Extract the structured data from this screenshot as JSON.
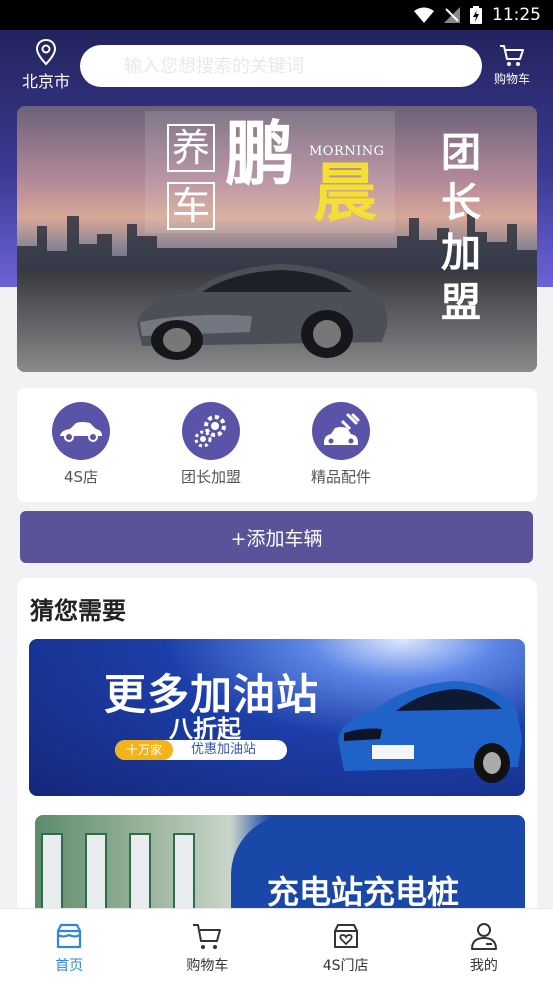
{
  "status_bar": {
    "time": "11:25"
  },
  "header": {
    "location": "北京市",
    "search_placeholder": "输入您想搜索的关键词",
    "cart_label": "购物车"
  },
  "banner": {
    "char_yang": "养",
    "char_che": "车",
    "char_peng": "鹏",
    "morning": "MORNING",
    "char_chen": "晨",
    "vertical_text": "团长加盟"
  },
  "quick_actions": [
    {
      "label": "4S店",
      "icon": "car-icon"
    },
    {
      "label": "团长加盟",
      "icon": "gears-icon"
    },
    {
      "label": "精品配件",
      "icon": "car-repair-icon"
    }
  ],
  "add_vehicle": {
    "label": "+添加车辆"
  },
  "recommend": {
    "title": "猜您需要",
    "promo_gas": {
      "headline": "更多加油站",
      "sub": "八折起",
      "tag": "十万家",
      "tag_text": "优惠加油站"
    },
    "promo_charge": {
      "headline": "充电站充电桩"
    }
  },
  "tabbar": [
    {
      "label": "首页",
      "icon": "home-store-icon",
      "active": true
    },
    {
      "label": "购物车",
      "icon": "cart-icon",
      "active": false
    },
    {
      "label": "4S门店",
      "icon": "shop-heart-icon",
      "active": false
    },
    {
      "label": "我的",
      "icon": "user-icon",
      "active": false
    }
  ],
  "colors": {
    "primary": "#5a539a",
    "tab_active": "#2f86e0",
    "header_gradient_top": "#23235e"
  }
}
